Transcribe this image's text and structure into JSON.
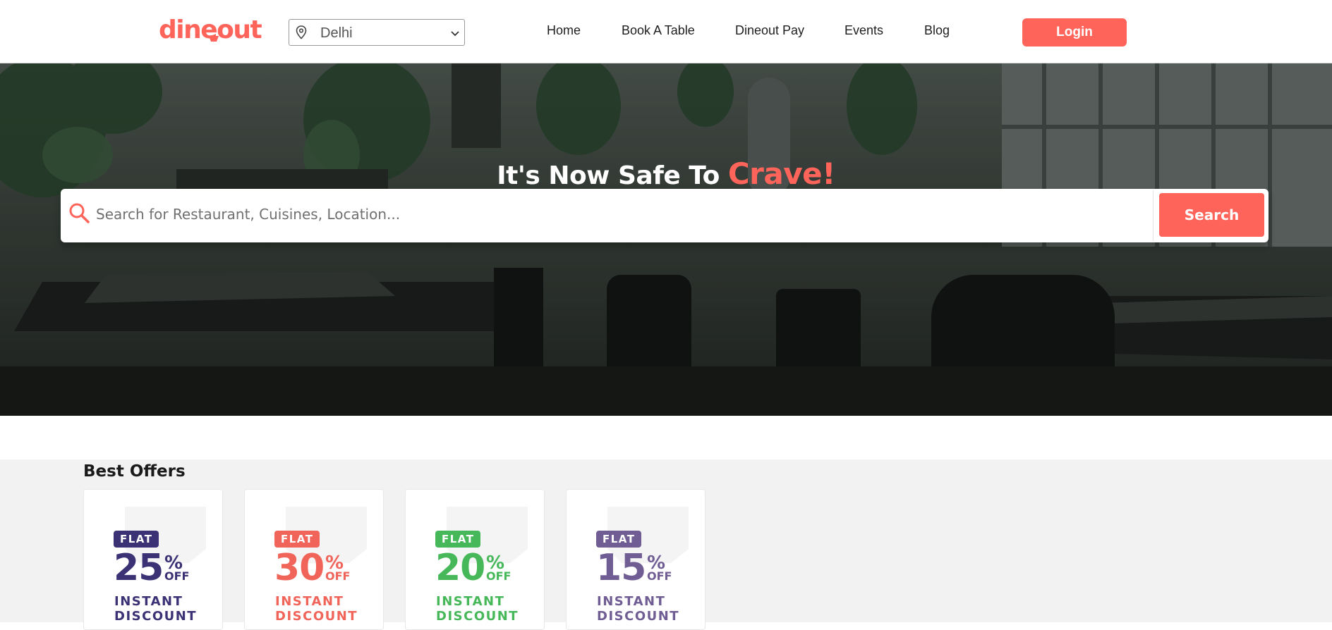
{
  "header": {
    "logo_text": "dineout",
    "city": {
      "value": "Delhi",
      "icon": "location-pin-icon"
    },
    "nav": [
      "Home",
      "Book A Table",
      "Dineout Pay",
      "Events",
      "Blog"
    ],
    "login_label": "Login"
  },
  "hero": {
    "title_prefix": "It's Now Safe To ",
    "title_accent": "Crave!",
    "search": {
      "placeholder": "Search for Restaurant, Cuisines, Location...",
      "value": "",
      "button_label": "Search"
    }
  },
  "offers": {
    "title": "Best Offers",
    "cards": [
      {
        "flat": "FLAT",
        "percent": "25",
        "symbol": "%",
        "off": "OFF",
        "line1": "INSTANT",
        "line2": "DISCOUNT",
        "color": "#3a3275"
      },
      {
        "flat": "FLAT",
        "percent": "30",
        "symbol": "%",
        "off": "OFF",
        "line1": "INSTANT",
        "line2": "DISCOUNT",
        "color": "#f0645a"
      },
      {
        "flat": "FLAT",
        "percent": "20",
        "symbol": "%",
        "off": "OFF",
        "line1": "INSTANT",
        "line2": "DISCOUNT",
        "color": "#47b85a"
      },
      {
        "flat": "FLAT",
        "percent": "15",
        "symbol": "%",
        "off": "OFF",
        "line1": "INSTANT",
        "line2": "DISCOUNT",
        "color": "#6f5d94"
      }
    ]
  },
  "colors": {
    "brand": "#ff645a",
    "text": "#1e1e1e",
    "offers_bg": "#f2f2f2"
  }
}
